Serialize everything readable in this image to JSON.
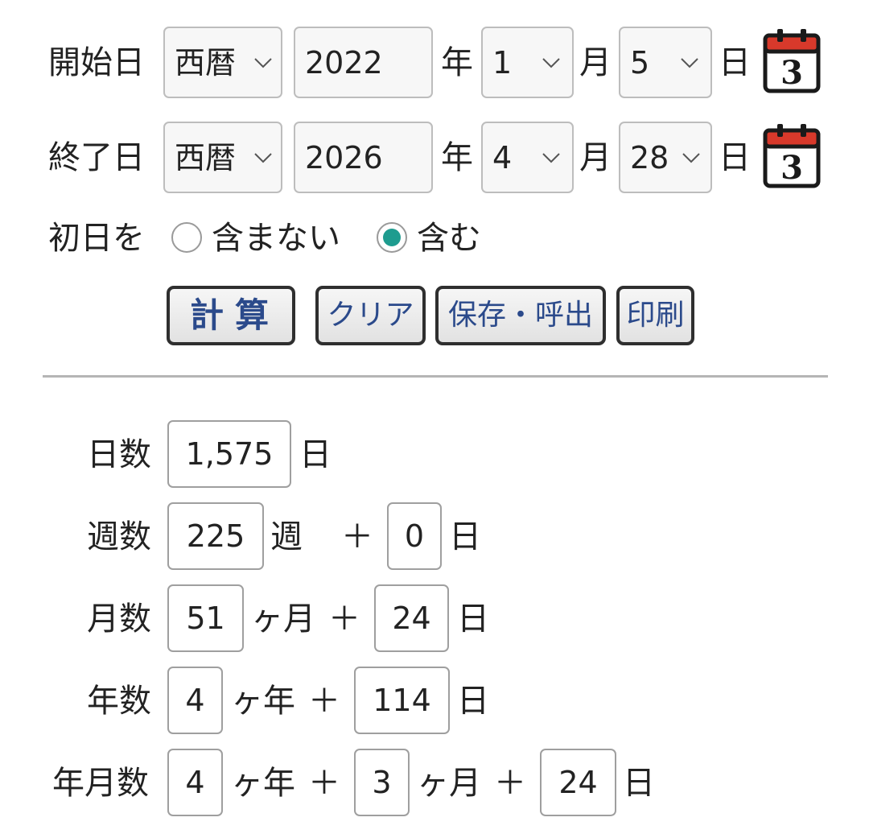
{
  "start": {
    "label": "開始日",
    "era": "西暦",
    "year": "2022",
    "year_unit": "年",
    "month": "1",
    "month_unit": "月",
    "day": "5",
    "day_unit": "日",
    "calendar_glyph": "3"
  },
  "end": {
    "label": "終了日",
    "era": "西暦",
    "year": "2026",
    "year_unit": "年",
    "month": "4",
    "month_unit": "月",
    "day": "28",
    "day_unit": "日",
    "calendar_glyph": "3"
  },
  "first_day": {
    "label": "初日を",
    "options": [
      "含まない",
      "含む"
    ],
    "selected": "含む"
  },
  "buttons": {
    "calculate": "計算",
    "clear": "クリア",
    "save_load": "保存・呼出",
    "print": "印刷"
  },
  "results": {
    "days": {
      "label": "日数",
      "value": "1,575",
      "unit": "日"
    },
    "weeks": {
      "label": "週数",
      "value": "225",
      "unit": "週",
      "plus": "＋",
      "rem": "0",
      "rem_unit": "日"
    },
    "months": {
      "label": "月数",
      "value": "51",
      "unit": "ヶ月",
      "plus": "＋",
      "rem": "24",
      "rem_unit": "日"
    },
    "years": {
      "label": "年数",
      "value": "4",
      "unit": "ヶ年",
      "plus": "＋",
      "rem": "114",
      "rem_unit": "日"
    },
    "ymd": {
      "label": "年月数",
      "years": "4",
      "years_unit": "ヶ年",
      "plus1": "＋",
      "months": "3",
      "months_unit": "ヶ月",
      "plus2": "＋",
      "days": "24",
      "days_unit": "日"
    }
  },
  "colors": {
    "accent": "#1e9c8f",
    "button_text": "#2b4a8b",
    "calendar_red": "#d8392b"
  },
  "icons": {
    "calendar": "calendar-icon",
    "dropdown": "chevron-down-icon"
  }
}
